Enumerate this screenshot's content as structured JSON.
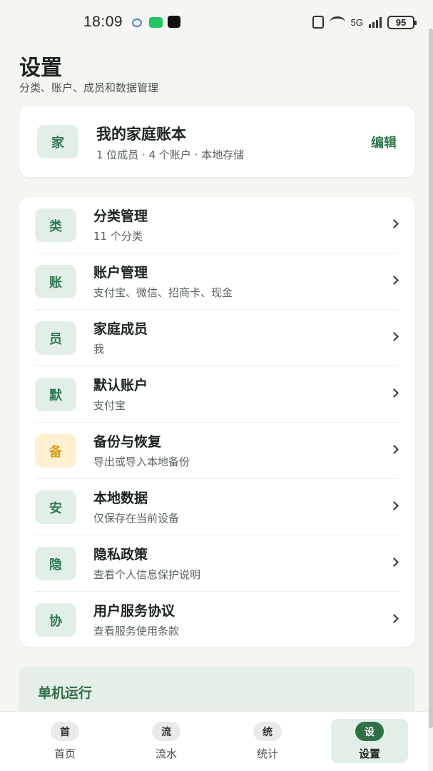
{
  "status_bar": {
    "time": "18:09",
    "battery": "95",
    "network": "5G",
    "icons": [
      "message-icon",
      "wechat-icon",
      "tiktok-icon",
      "nfc-icon",
      "wifi-icon",
      "signal-icon",
      "battery-icon"
    ]
  },
  "header": {
    "title": "设置",
    "subtitle": "分类、账户、成员和数据管理"
  },
  "book": {
    "badge": "家",
    "name": "我的家庭账本",
    "meta": "1 位成员 · 4 个账户 · 本地存储",
    "edit_label": "编辑"
  },
  "settings": {
    "items": [
      {
        "badge": "类",
        "title": "分类管理",
        "subtitle": "11 个分类"
      },
      {
        "badge": "账",
        "title": "账户管理",
        "subtitle": "支付宝、微信、招商卡、现金"
      },
      {
        "badge": "员",
        "title": "家庭成员",
        "subtitle": "我"
      },
      {
        "badge": "默",
        "title": "默认账户",
        "subtitle": "支付宝"
      },
      {
        "badge": "备",
        "title": "备份与恢复",
        "subtitle": "导出或导入本地备份"
      },
      {
        "badge": "安",
        "title": "本地数据",
        "subtitle": "仅保存在当前设备"
      },
      {
        "badge": "隐",
        "title": "隐私政策",
        "subtitle": "查看个人信息保护说明"
      },
      {
        "badge": "协",
        "title": "用户服务协议",
        "subtitle": "查看服务使用条款"
      }
    ]
  },
  "offline": {
    "title": "单机运行"
  },
  "nav": {
    "items": [
      {
        "icon": "首",
        "label": "首页"
      },
      {
        "icon": "流",
        "label": "流水"
      },
      {
        "icon": "统",
        "label": "统计"
      },
      {
        "icon": "设",
        "label": "设置"
      }
    ],
    "active": "设置"
  },
  "colors": {
    "accent": "#2f7a52",
    "badge_bg": "#e3efe6",
    "warn_badge_bg": "#fdf1d2",
    "warn_badge_fg": "#d9a21e",
    "page_bg": "#f5f6f2"
  }
}
